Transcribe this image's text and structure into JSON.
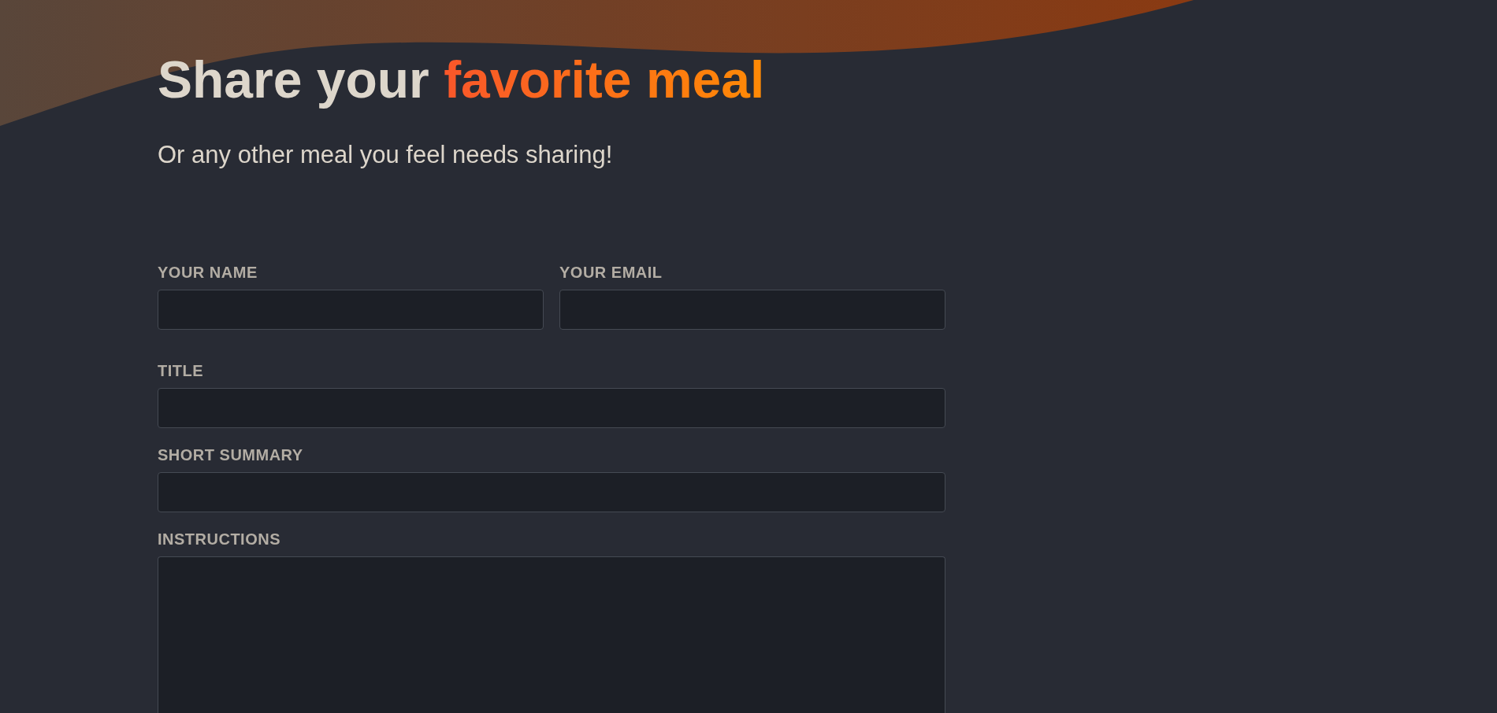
{
  "header": {
    "title": "Share your",
    "title_highlight": "favorite meal",
    "subtitle": "Or any other meal you feel needs sharing!"
  },
  "form": {
    "rows": [
      {
        "fields": [
          {
            "label": "YOUR NAME",
            "kind": "input"
          },
          {
            "label": "YOUR EMAIL",
            "kind": "input"
          }
        ]
      },
      {
        "fields": [
          {
            "label": "TITLE",
            "kind": "input"
          }
        ]
      },
      {
        "fields": [
          {
            "label": "SHORT SUMMARY",
            "kind": "input"
          }
        ]
      },
      {
        "fields": [
          {
            "label": "INSTRUCTIONS",
            "kind": "textarea"
          }
        ]
      }
    ]
  }
}
